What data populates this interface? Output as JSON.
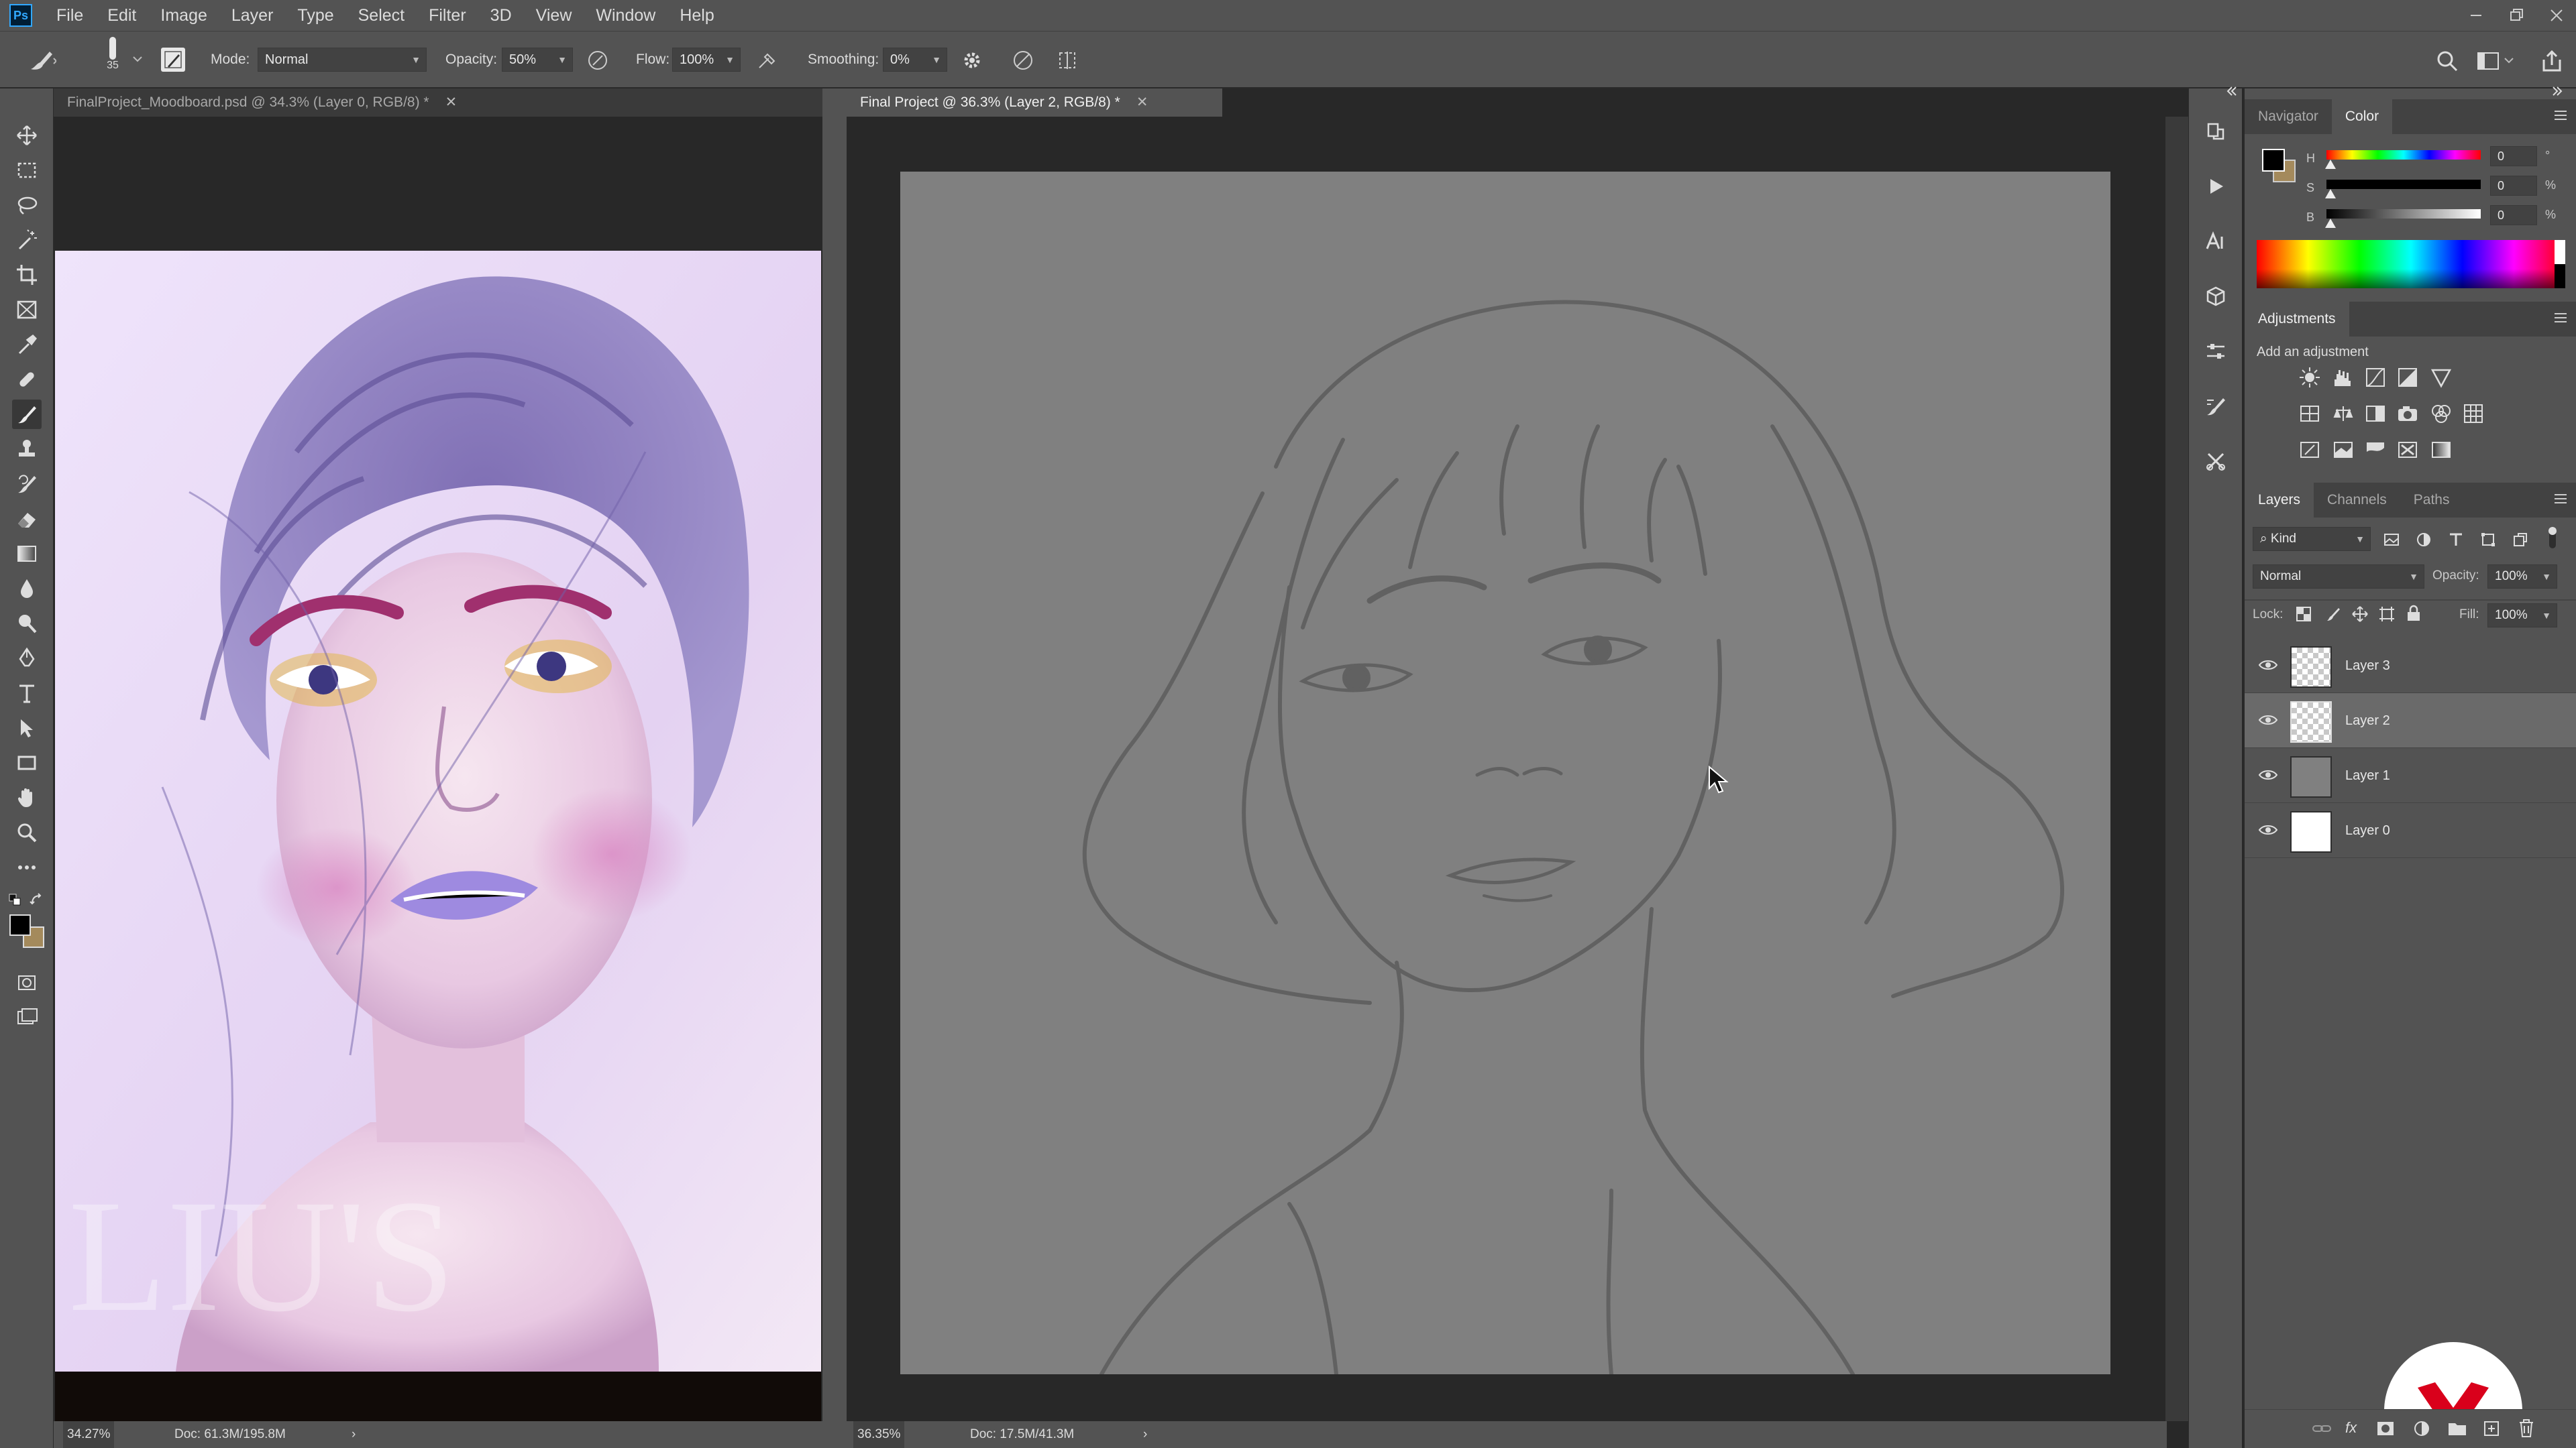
{
  "app": {
    "logo": "Ps"
  },
  "menu": [
    "File",
    "Edit",
    "Image",
    "Layer",
    "Type",
    "Select",
    "Filter",
    "3D",
    "View",
    "Window",
    "Help"
  ],
  "options": {
    "brush_size": "35",
    "mode_label": "Mode:",
    "mode_value": "Normal",
    "opacity_label": "Opacity:",
    "opacity_value": "50%",
    "flow_label": "Flow:",
    "flow_value": "100%",
    "smoothing_label": "Smoothing:",
    "smoothing_value": "0%"
  },
  "documents": [
    {
      "tab": "FinalProject_Moodboard.psd @ 34.3% (Layer 0, RGB/8) *",
      "zoom": "34.27%",
      "doc": "Doc: 61.3M/195.8M"
    },
    {
      "tab": "Final Project @ 36.3% (Layer 2, RGB/8) *",
      "zoom": "36.35%",
      "doc": "Doc: 17.5M/41.3M"
    }
  ],
  "color_panel": {
    "tabs": [
      "Navigator",
      "Color"
    ],
    "active_tab": "Color",
    "h_label": "H",
    "h_value": "0",
    "h_unit": "°",
    "s_label": "S",
    "s_value": "0",
    "s_unit": "%",
    "b_label": "B",
    "b_value": "0",
    "b_unit": "%"
  },
  "adjustments": {
    "title": "Adjustments",
    "subtitle": "Add an adjustment"
  },
  "layers_panel": {
    "tabs": [
      "Layers",
      "Channels",
      "Paths"
    ],
    "filter_label": "Kind",
    "blend_mode": "Normal",
    "opacity_label": "Opacity:",
    "opacity_value": "100%",
    "lock_label": "Lock:",
    "fill_label": "Fill:",
    "fill_value": "100%",
    "layers": [
      {
        "name": "Layer 3",
        "thumb": "transparent",
        "selected": false
      },
      {
        "name": "Layer 2",
        "thumb": "transparent",
        "selected": true
      },
      {
        "name": "Layer 1",
        "thumb": "gray",
        "selected": false
      },
      {
        "name": "Layer 0",
        "thumb": "white",
        "selected": false
      }
    ]
  },
  "moodboard_watermark": "LIU'S",
  "colors": {
    "ui_bg": "#535353",
    "canvas_bg": "#808080",
    "accent": "#31a8ff",
    "brand_badge": "#d9001b"
  }
}
